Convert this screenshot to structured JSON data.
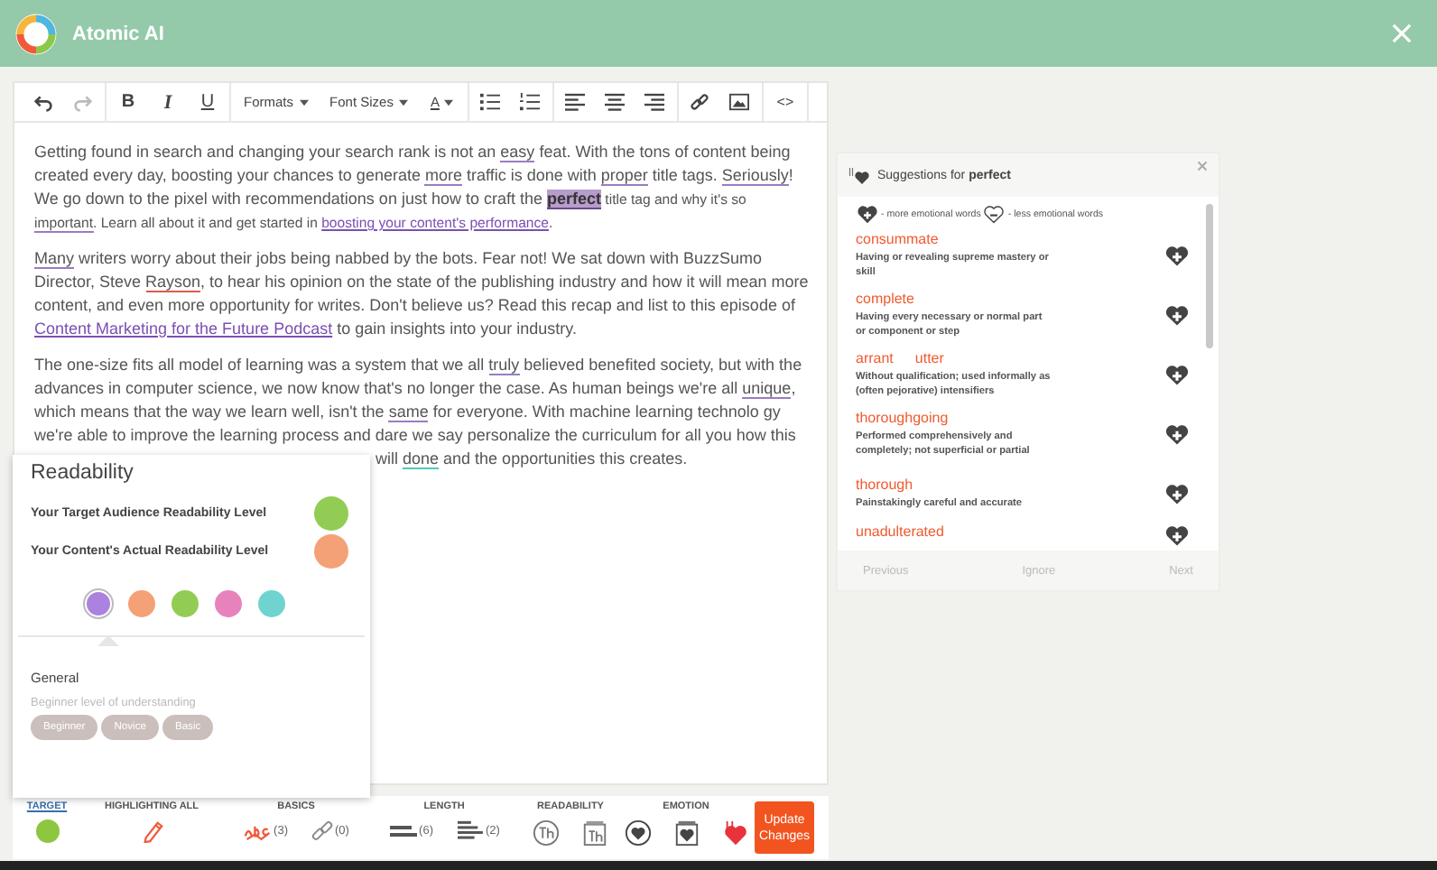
{
  "app": {
    "title": "Atomic AI"
  },
  "editor": {
    "toolbar": [
      [
        {
          "kind": "undo",
          "disabled": false
        },
        {
          "kind": "redo",
          "disabled": true
        }
      ],
      [
        {
          "kind": "bold",
          "label": "B"
        },
        {
          "kind": "italic",
          "label": "I"
        },
        {
          "kind": "underline",
          "label": "U"
        }
      ],
      [
        {
          "kind": "dropdown",
          "label": "Formats"
        },
        {
          "kind": "dropdown",
          "label": "Font Sizes"
        },
        {
          "kind": "color",
          "label": "A"
        }
      ],
      [
        {
          "kind": "bullets"
        },
        {
          "kind": "numbers"
        }
      ],
      [
        {
          "kind": "align-left"
        },
        {
          "kind": "align-center"
        },
        {
          "kind": "align-right"
        }
      ],
      [
        {
          "kind": "link"
        },
        {
          "kind": "image"
        }
      ],
      [
        {
          "kind": "code",
          "label": "<>"
        }
      ]
    ],
    "paragraphs": [
      [
        {
          "text": "Getting found in search and changing your search rank is not an ",
          "kind": "plain"
        },
        {
          "text": "easy",
          "kind": "flag",
          "color": "#9b7bc4"
        },
        {
          "text": " feat. With the tons of content being created every day, boosting your chances to generate ",
          "kind": "plain"
        },
        {
          "text": "more",
          "kind": "flag",
          "color": "#9b7bc4"
        },
        {
          "text": " traffic is done with ",
          "kind": "plain"
        },
        {
          "text": "proper",
          "kind": "flag",
          "color": "#9b7bc4"
        },
        {
          "text": " title tags. ",
          "kind": "plain"
        },
        {
          "text": "Seriously",
          "kind": "flag",
          "color": "#9b7bc4"
        },
        {
          "text": "! We go down to the pixel with recommendations on just how to craft the ",
          "kind": "plain"
        },
        {
          "text": "perfect",
          "kind": "highlight"
        },
        {
          "text": " title tag and why it's so ",
          "kind": "plain",
          "small": true
        },
        {
          "text": "important",
          "kind": "flag",
          "color": "#9b7bc4",
          "small": true
        },
        {
          "text": ". Learn all about it and get started in ",
          "kind": "plain",
          "small": true
        },
        {
          "text": "boosting your content's performance",
          "kind": "link",
          "small": true
        },
        {
          "text": ".",
          "kind": "plain",
          "small": true
        }
      ],
      [
        {
          "text": "Many",
          "kind": "flag",
          "color": "#9b7bc4"
        },
        {
          "text": " writers worry about their jobs being nabbed by the bots. Fear not! We sat down with BuzzSumo Director, Steve ",
          "kind": "plain"
        },
        {
          "text": "Rayson",
          "kind": "flag",
          "color": "#e0584f"
        },
        {
          "text": ", to hear his opinion on the state of the publishing industry and how it will mean more content, and even more opportunity for writes. Don't believe us? Read this recap and list to this episode of ",
          "kind": "plain"
        },
        {
          "text": "Content Marketing for the Future Podcast",
          "kind": "link"
        },
        {
          "text": " to gain insights into your industry.",
          "kind": "plain"
        }
      ],
      [
        {
          "text": "The one-size fits all model of learning was a system that we all ",
          "kind": "plain"
        },
        {
          "text": "truly",
          "kind": "flag",
          "color": "#9b7bc4"
        },
        {
          "text": " believed benefited society, but with the advances in computer science, we now know that's no longer the case. As human beings we're all ",
          "kind": "plain"
        },
        {
          "text": "unique",
          "kind": "flag",
          "color": "#9b7bc4"
        },
        {
          "text": ", which means that the way we learn well, isn't the ",
          "kind": "plain"
        },
        {
          "text": "same",
          "kind": "flag",
          "color": "#9b7bc4"
        },
        {
          "text": " for everyone. With machine learning technolo gy we're able to improve the learning process and dare we say personalize the curriculum for all",
          "kind": "plain"
        },
        {
          "text": " you how this will ",
          "kind": "plain"
        },
        {
          "text": "done",
          "kind": "flag",
          "color": "#4fc9b9"
        },
        {
          "text": " and the opportunities this creates.",
          "kind": "plain"
        }
      ]
    ]
  },
  "readability": {
    "title": "Readability",
    "levels": [
      {
        "label": "Your Target Audience Readability Level",
        "color": "#92cc55"
      },
      {
        "label": "Your Content's Actual Readability Level",
        "color": "#f5a177"
      }
    ],
    "choices": [
      {
        "color": "#ab82e0",
        "selected": true
      },
      {
        "color": "#f5a177",
        "selected": false
      },
      {
        "color": "#92cc55",
        "selected": false
      },
      {
        "color": "#e882bd",
        "selected": false
      },
      {
        "color": "#6fd4cf",
        "selected": false
      }
    ],
    "group": "General",
    "description": "Beginner level of understanding",
    "tags": [
      "Beginner",
      "Novice",
      "Basic"
    ]
  },
  "suggestions": {
    "heading": "Suggestions for **perfect**",
    "legend_more": "- more emotional words",
    "legend_less": "- less emotional words",
    "items": [
      {
        "words": [
          "consummate"
        ],
        "definition": "Having or revealing supreme mastery or skill"
      },
      {
        "words": [
          "complete"
        ],
        "definition": "Having every necessary or normal part or component or step"
      },
      {
        "words": [
          "arrant",
          "utter"
        ],
        "definition": "Without qualification; used informally as (often pejorative) intensifiers"
      },
      {
        "words": [
          "thoroughgoing"
        ],
        "definition": "Performed comprehensively and completely; not superficial or partial"
      },
      {
        "words": [
          "thorough"
        ],
        "definition": "Painstakingly careful and accurate"
      },
      {
        "words": [
          "unadulterated"
        ]
      }
    ],
    "buttons": [
      {
        "label": "Previous",
        "disabled": true
      },
      {
        "label": "Ignore",
        "disabled": true
      },
      {
        "label": "Next",
        "disabled": true
      }
    ]
  },
  "bottom_bar": {
    "groups": [
      {
        "label": "TARGET",
        "selected": true,
        "items": [
          {
            "kind": "dot"
          }
        ]
      },
      {
        "label": "HIGHLIGHTING ALL",
        "selected": false,
        "items": [
          {
            "kind": "pencil"
          }
        ]
      },
      {
        "label": "BASICS",
        "selected": false,
        "items": [
          {
            "kind": "spelling",
            "count": "(3)"
          },
          {
            "kind": "broken-link",
            "count": "(0)"
          }
        ]
      },
      {
        "label": "LENGTH",
        "selected": false,
        "items": [
          {
            "kind": "short-lines",
            "count": "(6)"
          },
          {
            "kind": "long-lines",
            "count": "(2)"
          }
        ]
      },
      {
        "label": "READABILITY",
        "selected": false,
        "items": [
          {
            "kind": "th-circle"
          },
          {
            "kind": "th-box"
          }
        ]
      },
      {
        "label": "EMOTION",
        "selected": false,
        "items": [
          {
            "kind": "heart-circle"
          },
          {
            "kind": "heart-box"
          },
          {
            "kind": "heart-red"
          }
        ]
      }
    ],
    "update_button": "Update Changes"
  }
}
